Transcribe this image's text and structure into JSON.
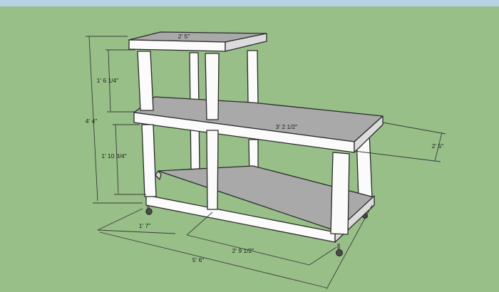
{
  "colors": {
    "sky": "#b6d3e6",
    "ground": "#98bf88",
    "wood_light": "#fbfbfb",
    "wood_shade": "#dcdcdc",
    "shelf_top": "#a9a9a9",
    "shelf_edge": "#d6d6d6",
    "edge": "#2b2b2b",
    "caster": "#4a4a4a"
  },
  "dimensions": {
    "top_width": "2' 5\"",
    "upper_height": "1' 6 1/4\"",
    "total_height": "4' 4\"",
    "shelf_length": "3' 2 1/2\"",
    "right_depth": "2' 5\"",
    "lower_height": "1' 10 3/4\"",
    "front_left": "1' 7\"",
    "front_mid": "2' 9 1/2\"",
    "total_length": "5' 6\""
  }
}
